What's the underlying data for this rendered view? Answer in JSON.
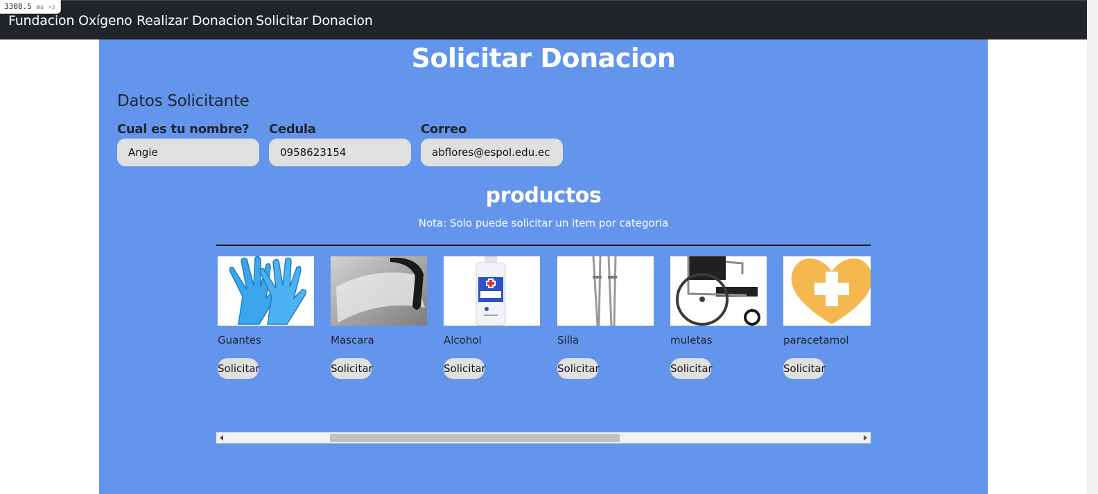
{
  "perf": {
    "value": "3308.5",
    "unit": "ms",
    "mult": "×3"
  },
  "nav": {
    "brand": "Fundacion Oxígeno",
    "links": [
      "Realizar Donacion",
      "Solicitar Donacion"
    ]
  },
  "page": {
    "title": "Solicitar Donacion",
    "section_title": "Datos Solicitante"
  },
  "form": {
    "name": {
      "label": "Cual es tu nombre?",
      "value": "Angie"
    },
    "cedula": {
      "label": "Cedula",
      "value": "0958623154"
    },
    "correo": {
      "label": "Correo",
      "value": "abflores@espol.edu.ec"
    }
  },
  "products": {
    "title": "productos",
    "note": "Nota: Solo puede solicitar un item por categoria",
    "button_label": "Solicitar",
    "items": [
      {
        "name": "Guantes",
        "icon": "gloves-image"
      },
      {
        "name": "Mascara",
        "icon": "face-shield-image"
      },
      {
        "name": "Alcohol",
        "icon": "alcohol-bottle-image"
      },
      {
        "name": "Silla",
        "icon": "crutches-image"
      },
      {
        "name": "muletas",
        "icon": "wheelchair-image"
      },
      {
        "name": "paracetamol",
        "icon": "heart-cross-image"
      }
    ]
  },
  "colors": {
    "navbar": "#212529",
    "panel": "#6495ed",
    "input": "#e0e0e0",
    "heart": "#f5b84f"
  }
}
